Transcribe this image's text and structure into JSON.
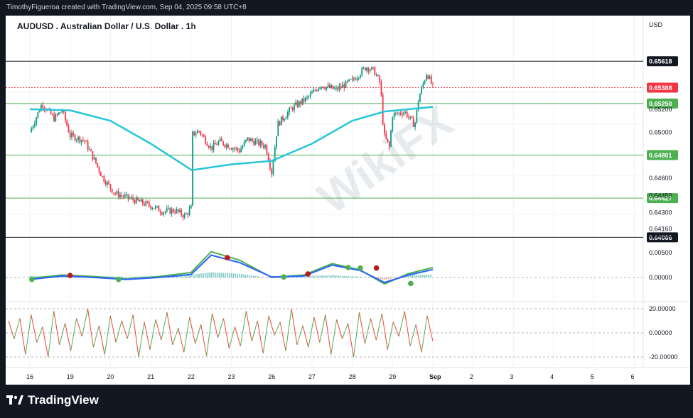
{
  "header": {
    "credit": "TimothyFigueroa created with TradingView.com, Sep 04, 2025 09:58 UTC+8"
  },
  "footer": {
    "logo_text": "TradingView"
  },
  "watermark": {
    "text": "WikiFX"
  },
  "chart_data": [
    {
      "type": "candlestick",
      "title": "AUDUSD . Australian Dollar / U.S. Dollar . 1h",
      "currency_label": "USD",
      "ylim": [
        0.6402,
        0.6578
      ],
      "y_ticks": [
        "0.65200",
        "0.65000",
        "0.64600",
        "0.64300",
        "0.64160",
        "0.64450",
        "0.64100"
      ],
      "y_tick_values": [
        0.652,
        0.65,
        0.646,
        0.643,
        0.6416,
        0.6445,
        0.641
      ],
      "x_ticks": [
        "16",
        "19",
        "20",
        "21",
        "22",
        "23",
        "26",
        "27",
        "28",
        "29",
        "Sep",
        "2",
        "3",
        "4",
        "5",
        "6"
      ],
      "x_tick_pos": [
        0,
        1,
        2,
        3,
        4,
        5,
        6,
        7,
        8,
        9,
        10,
        11,
        12,
        13,
        14,
        15
      ],
      "last_price": 0.65388,
      "price_path": [
        [
          0,
          0.65
        ],
        [
          0.3,
          0.6525
        ],
        [
          0.6,
          0.6512
        ],
        [
          0.8,
          0.6519
        ],
        [
          1.0,
          0.6497
        ],
        [
          1.35,
          0.6493
        ],
        [
          1.6,
          0.6476
        ],
        [
          1.8,
          0.6461
        ],
        [
          2.1,
          0.6447
        ],
        [
          2.5,
          0.6442
        ],
        [
          3.0,
          0.6436
        ],
        [
          3.3,
          0.6431
        ],
        [
          3.6,
          0.6432
        ],
        [
          3.85,
          0.6427
        ],
        [
          4.0,
          0.6434
        ],
        [
          4.02,
          0.6498
        ],
        [
          4.2,
          0.6501
        ],
        [
          4.5,
          0.6486
        ],
        [
          4.7,
          0.6492
        ],
        [
          5.2,
          0.6484
        ],
        [
          5.4,
          0.6494
        ],
        [
          5.85,
          0.6488
        ],
        [
          6.0,
          0.6465
        ],
        [
          6.15,
          0.6507
        ],
        [
          6.5,
          0.6521
        ],
        [
          6.9,
          0.653
        ],
        [
          7.2,
          0.6541
        ],
        [
          7.6,
          0.6537
        ],
        [
          8.0,
          0.6545
        ],
        [
          8.35,
          0.6557
        ],
        [
          8.55,
          0.6553
        ],
        [
          8.7,
          0.6542
        ],
        [
          8.78,
          0.6498
        ],
        [
          8.92,
          0.6487
        ],
        [
          9.0,
          0.6515
        ],
        [
          9.3,
          0.6518
        ],
        [
          9.55,
          0.6506
        ],
        [
          9.65,
          0.653
        ],
        [
          9.85,
          0.6552
        ],
        [
          10.0,
          0.6539
        ]
      ],
      "series": [
        {
          "name": "moving-average",
          "color": "#26c6da",
          "points": [
            [
              0,
              0.652
            ],
            [
              1.0,
              0.6519
            ],
            [
              2.0,
              0.651
            ],
            [
              3.0,
              0.649
            ],
            [
              4.02,
              0.6467
            ],
            [
              5.0,
              0.6472
            ],
            [
              6.0,
              0.6475
            ],
            [
              7.0,
              0.649
            ],
            [
              8.0,
              0.651
            ],
            [
              8.8,
              0.6518
            ],
            [
              10.0,
              0.6522
            ]
          ]
        }
      ],
      "levels": [
        {
          "value": 0.65618,
          "label": "0.65618",
          "style": "black"
        },
        {
          "value": 0.65388,
          "label": "0.65388",
          "style": "red"
        },
        {
          "value": 0.6525,
          "label": "0.65250",
          "style": "green"
        },
        {
          "value": 0.64801,
          "label": "0.64801",
          "style": "green"
        },
        {
          "value": 0.64427,
          "label": "0.64427",
          "style": "green"
        },
        {
          "value": 0.64086,
          "label": "0.64086",
          "style": "black"
        }
      ]
    },
    {
      "type": "line",
      "title": "",
      "y_ticks": [
        "0.00500",
        "0.00000"
      ],
      "series": [
        {
          "name": "fast",
          "color": "#4caf50",
          "points": [
            [
              0,
              -0.0002
            ],
            [
              0.8,
              0.0005
            ],
            [
              1.6,
              0.0002
            ],
            [
              2.4,
              -0.0003
            ],
            [
              3.2,
              0.0002
            ],
            [
              4.0,
              0.001
            ],
            [
              4.5,
              0.0052
            ],
            [
              5.2,
              0.0035
            ],
            [
              6.0,
              0.0
            ],
            [
              6.8,
              0.0005
            ],
            [
              7.5,
              0.0028
            ],
            [
              8.2,
              0.0015
            ],
            [
              8.8,
              -0.0013
            ],
            [
              9.4,
              0.0008
            ],
            [
              10.0,
              0.002
            ]
          ]
        },
        {
          "name": "slow",
          "color": "#2962ff",
          "points": [
            [
              0,
              -0.0004
            ],
            [
              0.8,
              0.0003
            ],
            [
              1.6,
              0.0
            ],
            [
              2.4,
              -0.0004
            ],
            [
              3.2,
              0.0
            ],
            [
              4.0,
              0.0006
            ],
            [
              4.5,
              0.0045
            ],
            [
              5.2,
              0.003
            ],
            [
              6.0,
              0.0001
            ],
            [
              6.8,
              0.0003
            ],
            [
              7.5,
              0.0025
            ],
            [
              8.2,
              0.0014
            ],
            [
              8.8,
              -0.001
            ],
            [
              9.4,
              0.0005
            ],
            [
              10.0,
              0.0016
            ]
          ]
        }
      ],
      "dots": [
        {
          "x": 0.05,
          "value": -0.0004,
          "color": "#4caf50"
        },
        {
          "x": 1.0,
          "value": 0.0004,
          "color": "#b71c1c"
        },
        {
          "x": 2.2,
          "value": -0.0004,
          "color": "#4caf50"
        },
        {
          "x": 4.9,
          "value": 0.004,
          "color": "#b71c1c"
        },
        {
          "x": 6.3,
          "value": 0.0001,
          "color": "#4caf50"
        },
        {
          "x": 6.9,
          "value": 0.0007,
          "color": "#b71c1c"
        },
        {
          "x": 7.9,
          "value": 0.002,
          "color": "#4caf50"
        },
        {
          "x": 8.2,
          "value": 0.0019,
          "color": "#4caf50"
        },
        {
          "x": 8.6,
          "value": 0.0019,
          "color": "#b71c1c"
        },
        {
          "x": 9.45,
          "value": -0.0012,
          "color": "#4caf50"
        }
      ]
    },
    {
      "type": "line",
      "title": "",
      "y_ticks": [
        "20.00000",
        "0.00000",
        "-20.00000"
      ],
      "series": [
        {
          "name": "oscillator",
          "color_up": "#4caf50",
          "color_down": "#f44336",
          "values": [
            10,
            -5,
            12,
            -18,
            15,
            -8,
            5,
            -20,
            18,
            -10,
            8,
            -15,
            12,
            -3,
            20,
            -12,
            6,
            -18,
            14,
            -8,
            10,
            -5,
            15,
            -20,
            9,
            -14,
            11,
            -6,
            17,
            -10,
            4,
            -16,
            13,
            -9,
            7,
            -19,
            16,
            -4,
            12,
            -13,
            5,
            -11,
            18,
            -7,
            10,
            -17,
            14,
            -2,
            9,
            -15,
            20,
            -10,
            6,
            -12,
            13,
            -8,
            15,
            -18,
            11,
            -5,
            8,
            -20,
            17,
            -9,
            12,
            -6,
            16,
            -14,
            9,
            -3,
            18,
            -11,
            7,
            -16,
            14,
            -7
          ]
        }
      ]
    }
  ]
}
